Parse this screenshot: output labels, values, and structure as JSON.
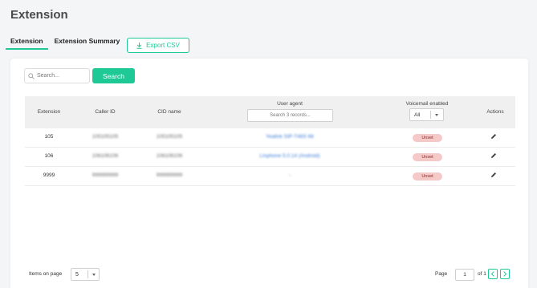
{
  "page": {
    "title": "Extension"
  },
  "tabs": [
    {
      "label": "Extension",
      "active": true
    },
    {
      "label": "Extension Summary",
      "active": false
    }
  ],
  "toolbar": {
    "export_label": "Export CSV",
    "export_icon": "download-icon"
  },
  "search": {
    "placeholder": "Search...",
    "button_label": "Search"
  },
  "table": {
    "headers": {
      "extension": "Extension",
      "caller_id": "Caller ID",
      "cid_name": "CID name",
      "user_agent": "User agent",
      "voicemail": "Voicemail enabled",
      "actions": "Actions"
    },
    "user_agent_filter_placeholder": "Search 3 records...",
    "voicemail_filter_value": "All",
    "rows": [
      {
        "extension": "105",
        "caller_id": "105105105",
        "cid_name": "105105105",
        "user_agent": "Yealink SIP-T46S 66",
        "voicemail": "Unset"
      },
      {
        "extension": "106",
        "caller_id": "106106106",
        "cid_name": "106106106",
        "user_agent": "Linphone 5.0.14 (Android)",
        "voicemail": "Unset"
      },
      {
        "extension": "9999",
        "caller_id": "999999999",
        "cid_name": "999999999",
        "user_agent": "-",
        "voicemail": "Unset"
      }
    ]
  },
  "pagination": {
    "items_label": "Items on page",
    "page_size": "5",
    "page_label": "Page",
    "current_page": "1",
    "of_label": "of 1"
  },
  "colors": {
    "accent": "#1ec996",
    "badge_bg": "#f6c9c9",
    "link": "#3a7bd5"
  }
}
